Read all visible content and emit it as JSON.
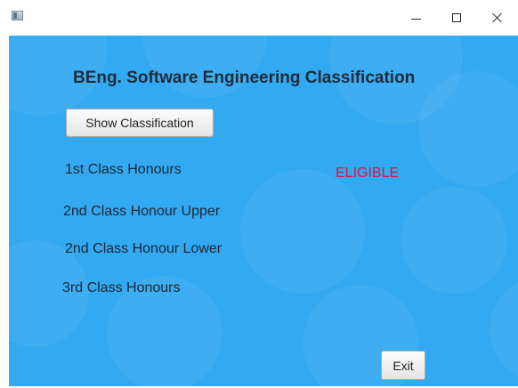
{
  "window": {
    "icon": "app-window-icon",
    "controls": {
      "minimize_icon": "minimize-icon",
      "maximize_icon": "maximize-icon",
      "close_icon": "close-icon"
    }
  },
  "main": {
    "title": "BEng. Software Engineering Classification",
    "show_button_label": "Show Classification",
    "classifications": [
      "1st Class Honours",
      "2nd Class Honour Upper",
      "2nd Class Honour Lower",
      "3rd Class Honours"
    ],
    "status_text": "ELIGIBLE",
    "exit_button_label": "Exit"
  },
  "colors": {
    "background": "#33a9f1",
    "status": "#e0123b",
    "text": "#1d2733"
  }
}
